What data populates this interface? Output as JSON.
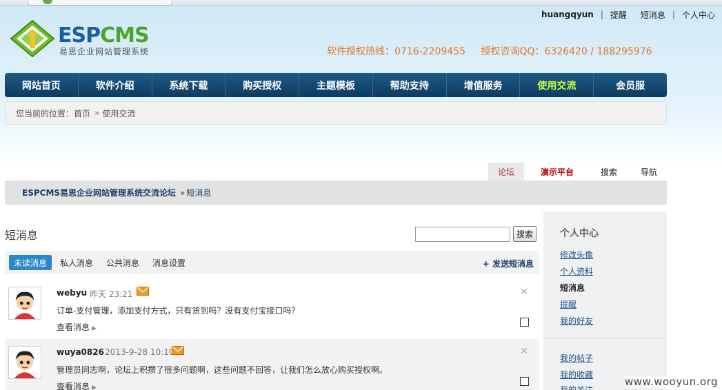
{
  "toplinks": {
    "user": "huangqyun",
    "remind": "提醒",
    "messages": "短消息",
    "center": "个人中心"
  },
  "logo": {
    "brand_a": "ESP",
    "brand_b": "CMS",
    "subtitle": "易思企业网站管理系统"
  },
  "hotline": {
    "license_line": "软件授权热线：0716-2209455",
    "qq_line": "授权咨询QQ：6326420 / 188295976"
  },
  "nav": {
    "items": [
      "网站首页",
      "软件介绍",
      "系统下载",
      "购买授权",
      "主题模板",
      "帮助支持",
      "增值服务",
      "使用交流",
      "会员服"
    ],
    "active_index": 7
  },
  "breadcrumb": {
    "prefix": "您当前的位置：首页",
    "arrow": "»",
    "current": "使用交流"
  },
  "forum_tabs": [
    "论坛",
    "演示平台",
    "搜索",
    "导航"
  ],
  "forumbar": {
    "forum_name": "ESPCMS易思企业网站管理系统交流论坛",
    "arrow": "»",
    "current": "短消息"
  },
  "page": {
    "title": "短消息",
    "search_button": "搜索",
    "search_value": ""
  },
  "msg_tabs": {
    "items": [
      "未读消息",
      "私人消息",
      "公共消息",
      "消息设置"
    ],
    "active_index": 0,
    "send": "+ 发送短消息"
  },
  "messages": [
    {
      "user": "webyu",
      "time": "昨天  23:21",
      "text": "订单-支付管理，添加支付方式，只有货到吗？没有支付宝接口吗？",
      "view": "查看消息"
    },
    {
      "user": "wuya0826",
      "time": "2013-9-28 10:10",
      "text": "管理员同志啊，论坛上积攒了很多问题啊，这些问题不回答，让我们怎么放心购买授权啊。",
      "view": "查看消息"
    }
  ],
  "side": {
    "heading": "个人中心",
    "links": [
      "修改头像",
      "个人资料",
      "短消息",
      "提醒",
      "我的好友",
      "我的帖子",
      "我的收藏",
      "我的关注"
    ],
    "current_index": 2
  },
  "watermark": "www.wooyun.org",
  "colors": {
    "nav_bg": "#0e3b5e",
    "nav_active": "#c8ff3c",
    "hotline": "#e8742a",
    "tab_active": "#2a87c8"
  }
}
